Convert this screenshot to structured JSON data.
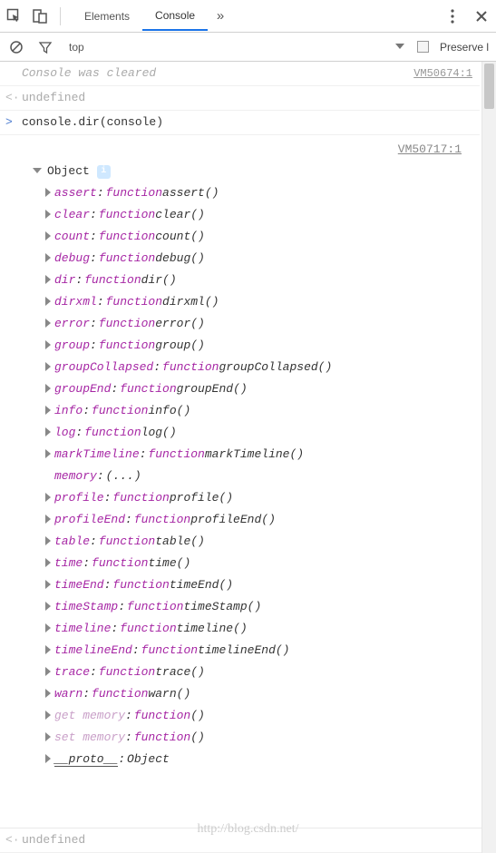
{
  "toolbar": {
    "tabs": {
      "elements": "Elements",
      "console": "Console"
    }
  },
  "filter": {
    "scope": "top",
    "preserve_label": "Preserve l"
  },
  "cleared_msg": "Console was cleared",
  "cleared_src": "VM50674:1",
  "input_code": "console.dir(console)",
  "obj_src": "VM50717:1",
  "obj_label": "Object",
  "undefined_label": "undefined",
  "proto_label": "__proto__",
  "proto_value": "Object",
  "kw_function": "function",
  "props": [
    {
      "key": "assert",
      "sig": "assert()"
    },
    {
      "key": "clear",
      "sig": "clear()"
    },
    {
      "key": "count",
      "sig": "count()"
    },
    {
      "key": "debug",
      "sig": "debug()"
    },
    {
      "key": "dir",
      "sig": "dir()"
    },
    {
      "key": "dirxml",
      "sig": "dirxml()"
    },
    {
      "key": "error",
      "sig": "error()"
    },
    {
      "key": "group",
      "sig": "group()"
    },
    {
      "key": "groupCollapsed",
      "sig": "groupCollapsed()"
    },
    {
      "key": "groupEnd",
      "sig": "groupEnd()"
    },
    {
      "key": "info",
      "sig": "info()"
    },
    {
      "key": "log",
      "sig": "log()"
    },
    {
      "key": "markTimeline",
      "sig": "markTimeline()"
    },
    {
      "key": "memory",
      "sig": "(...)",
      "no_arrow": true,
      "no_kw": true
    },
    {
      "key": "profile",
      "sig": "profile()"
    },
    {
      "key": "profileEnd",
      "sig": "profileEnd()"
    },
    {
      "key": "table",
      "sig": "table()"
    },
    {
      "key": "time",
      "sig": "time()"
    },
    {
      "key": "timeEnd",
      "sig": "timeEnd()"
    },
    {
      "key": "timeStamp",
      "sig": "timeStamp()"
    },
    {
      "key": "timeline",
      "sig": "timeline()"
    },
    {
      "key": "timelineEnd",
      "sig": "timelineEnd()"
    },
    {
      "key": "trace",
      "sig": "trace()"
    },
    {
      "key": "warn",
      "sig": "warn()"
    },
    {
      "key": "get memory",
      "sig": "()",
      "faded": true
    },
    {
      "key": "set memory",
      "sig": "()",
      "faded": true
    }
  ],
  "watermark": "http://blog.csdn.net/"
}
